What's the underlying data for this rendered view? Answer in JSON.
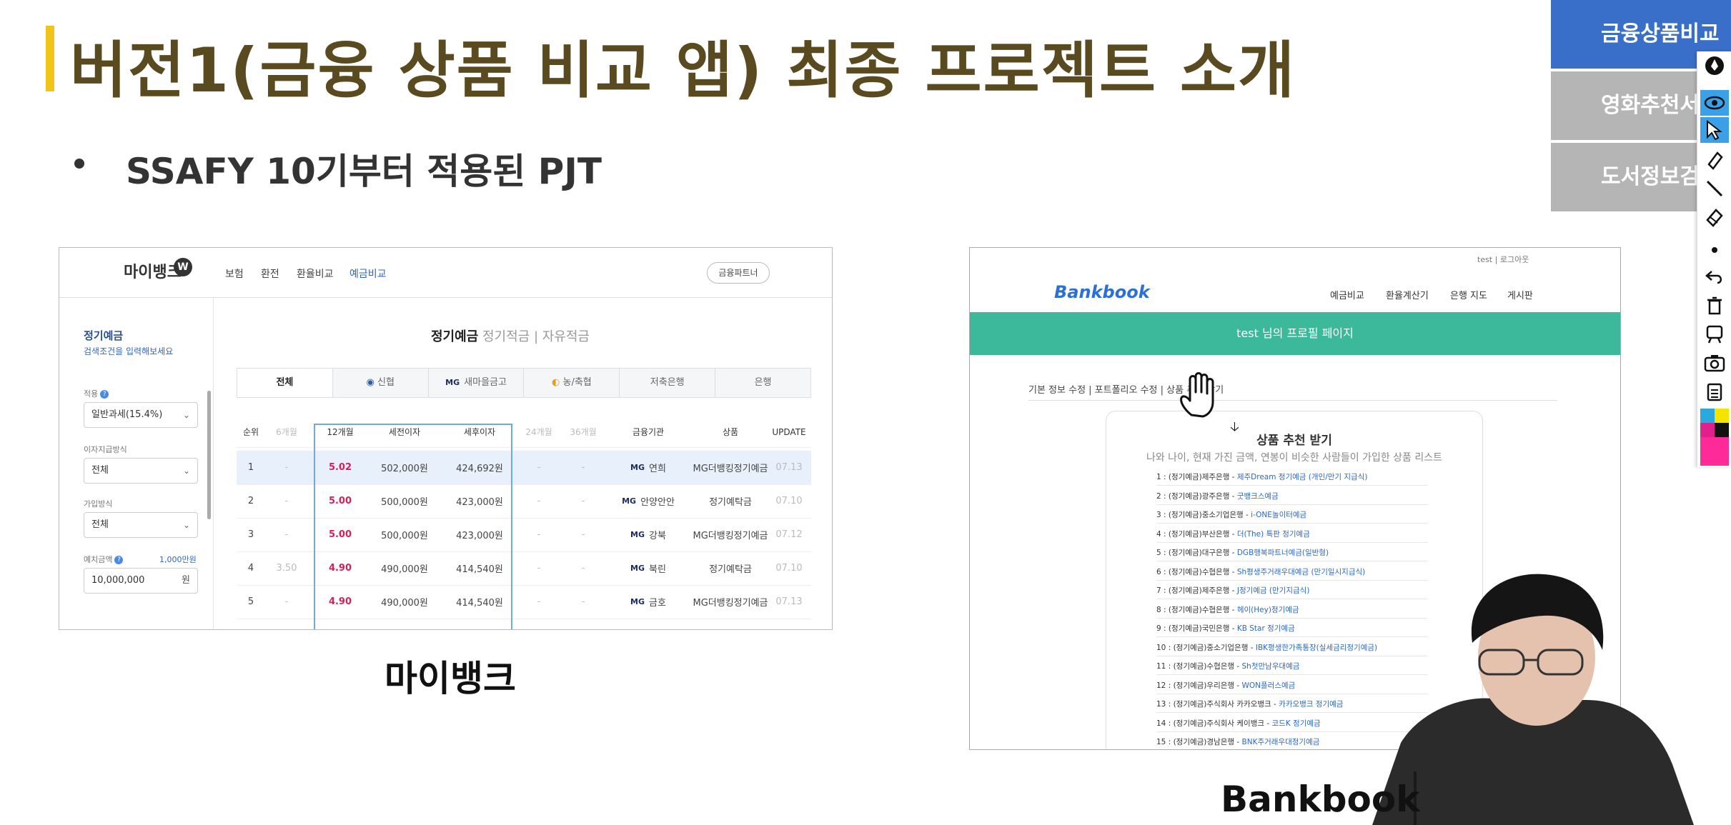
{
  "slide": {
    "title": "버전1(금융 상품 비교 앱) 최종 프로젝트 소개",
    "bullet": "SSAFY 10기부터 적용된 PJT",
    "caption_left": "마이뱅크",
    "caption_right": "Bankbook"
  },
  "right_menu": [
    {
      "label": "금융상품비교"
    },
    {
      "label": "영화추천서비스"
    },
    {
      "label": "도서정보검색"
    }
  ],
  "toolbar": {
    "tools": [
      "marker-tool-icon",
      "eye-icon",
      "pointer-icon",
      "highlighter-icon",
      "line-tool-icon",
      "eraser-icon",
      "dot-icon",
      "undo-icon",
      "trash-icon",
      "whiteboard-icon",
      "camera-icon",
      "clipboard-icon"
    ],
    "colors": [
      "#2aa8e0",
      "#f5e400",
      "#e0208c",
      "#ff2a9a"
    ]
  },
  "mybank": {
    "logo": "마이뱅크",
    "logo_badge": "W",
    "nav": [
      "보험",
      "환전",
      "환율비교",
      "예금비교"
    ],
    "finance_partner": "금융파트너",
    "sidebar": {
      "title": "정기예금",
      "subtitle": "검색조건을 입력해보세요",
      "tax_label": "적용",
      "tax_value": "일반과세(15.4%)",
      "interest_label": "이자지급방식",
      "interest_value": "전체",
      "join_label": "가입방식",
      "join_value": "전체",
      "amount_label": "예치금액",
      "amount_hint": "1,000만원",
      "amount_value": "10,000,000",
      "amount_unit": "원"
    },
    "main_tabs": {
      "active": "정기예금",
      "others": "정기적금 | 자유적금"
    },
    "tabs": [
      "전체",
      "신협",
      "새마을금고",
      "농/축협",
      "저축은행",
      "은행"
    ],
    "table_headers": [
      "순위",
      "6개월",
      "12개월",
      "세전이자",
      "세후이자",
      "24개월",
      "36개월",
      "금융기관",
      "상품",
      "UPDATE"
    ],
    "rows": [
      {
        "rank": "1",
        "m6": "-",
        "m12": "5.02",
        "pre": "502,000원",
        "post": "424,692원",
        "m24": "-",
        "m36": "-",
        "inst": "연희",
        "prod": "MG더뱅킹정기예금",
        "upd": "07.13"
      },
      {
        "rank": "2",
        "m6": "-",
        "m12": "5.00",
        "pre": "500,000원",
        "post": "423,000원",
        "m24": "-",
        "m36": "-",
        "inst": "안양안안",
        "prod": "정기예탁금",
        "upd": "07.10"
      },
      {
        "rank": "3",
        "m6": "-",
        "m12": "5.00",
        "pre": "500,000원",
        "post": "423,000원",
        "m24": "-",
        "m36": "-",
        "inst": "강북",
        "prod": "MG더뱅킹정기예금",
        "upd": "07.12"
      },
      {
        "rank": "4",
        "m6": "3.50",
        "m12": "4.90",
        "pre": "490,000원",
        "post": "414,540원",
        "m24": "-",
        "m36": "-",
        "inst": "북린",
        "prod": "정기예탁금",
        "upd": "07.10"
      },
      {
        "rank": "5",
        "m6": "-",
        "m12": "4.90",
        "pre": "490,000원",
        "post": "414,540원",
        "m24": "-",
        "m36": "-",
        "inst": "금호",
        "prod": "MG더뱅킹정기예금",
        "upd": "07.13"
      }
    ]
  },
  "bankbook": {
    "top_right": "test | 로그아웃",
    "logo": "Bankbook",
    "nav": [
      "예금비교",
      "환율계산기",
      "은행 지도",
      "게시판"
    ],
    "banner": "test 님의 프로필 페이지",
    "subnav": "기본 정보 수정 | 포트폴리오 수정 | 상품 추천 받기",
    "card_title": "상품 추천 받기",
    "card_subtitle": "나와 나이, 현재 가진 금액, 연봉이 비슷한 사람들이 가입한 상품 리스트",
    "items": [
      {
        "n": "1 : (정기예금)제주은행 - ",
        "p": "제주Dream 정기예금 (개인/만기 지급식)"
      },
      {
        "n": "2 : (정기예금)광주은행 - ",
        "p": "굿뱅크스예금"
      },
      {
        "n": "3 : (정기예금)중소기업은행 - ",
        "p": "i-ONE놀이터예금"
      },
      {
        "n": "4 : (정기예금)부산은행 - ",
        "p": "더(The) 특판 정기예금"
      },
      {
        "n": "5 : (정기예금)대구은행 - ",
        "p": "DGB행복파트너예금(일반형)"
      },
      {
        "n": "6 : (정기예금)수협은행 - ",
        "p": "Sh평생주거래우대예금 (만기일시지급식)"
      },
      {
        "n": "7 : (정기예금)제주은행 - ",
        "p": "J정기예금 (만기지급식)"
      },
      {
        "n": "8 : (정기예금)수협은행 - ",
        "p": "헤이(Hey)정기예금"
      },
      {
        "n": "9 : (정기예금)국민은행 - ",
        "p": "KB Star 정기예금"
      },
      {
        "n": "10 : (정기예금)중소기업은행 - ",
        "p": "IBK평생한가족통장(실세금리정기예금)"
      },
      {
        "n": "11 : (정기예금)수협은행 - ",
        "p": "Sh첫만남우대예금"
      },
      {
        "n": "12 : (정기예금)우리은행 - ",
        "p": "WON플러스예금"
      },
      {
        "n": "13 : (정기예금)주식회사 카카오뱅크 - ",
        "p": "카카오뱅크 정기예금"
      },
      {
        "n": "14 : (정기예금)주식회사 케이뱅크 - ",
        "p": "코드K 정기예금"
      },
      {
        "n": "15 : (정기예금)경남은행 - ",
        "p": "BNK주거래우대정기예금"
      }
    ]
  }
}
